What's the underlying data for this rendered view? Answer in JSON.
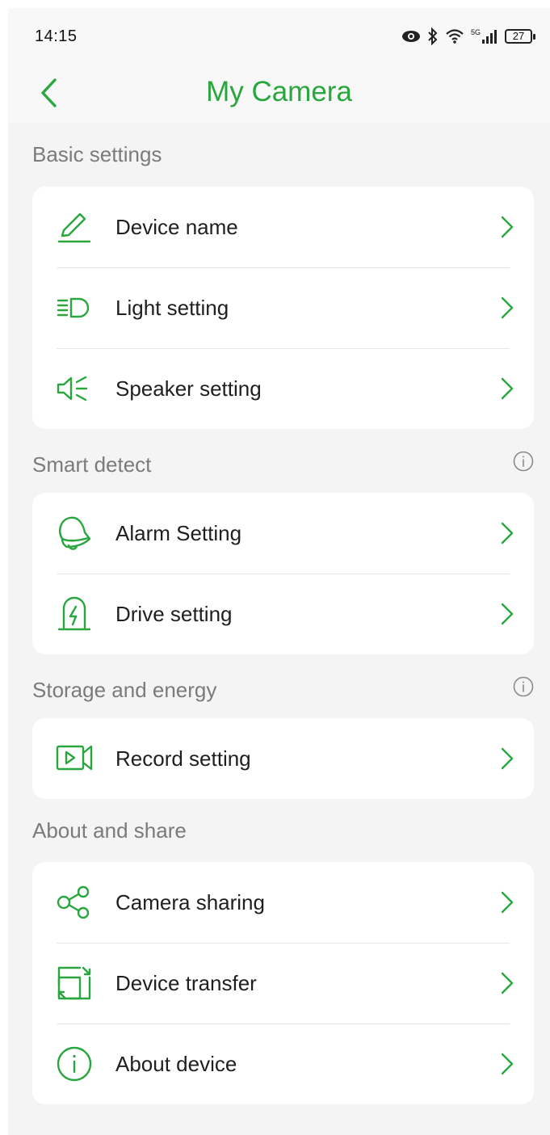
{
  "status_bar": {
    "time": "14:15",
    "network_label": "5G",
    "battery": "27",
    "icons": [
      "eye-icon",
      "bluetooth-icon",
      "wifi-icon",
      "signal-icon",
      "battery-icon"
    ]
  },
  "header": {
    "title": "My Camera",
    "back_icon": "chevron-left-icon"
  },
  "accent_color": "#2aa63e",
  "sections": [
    {
      "title": "Basic settings",
      "has_info": false,
      "items": [
        {
          "label": "Device name",
          "icon": "pencil-icon"
        },
        {
          "label": "Light setting",
          "icon": "headlight-icon"
        },
        {
          "label": "Speaker setting",
          "icon": "speaker-icon"
        }
      ]
    },
    {
      "title": "Smart detect",
      "has_info": true,
      "items": [
        {
          "label": "Alarm Setting",
          "icon": "alarm-bell-icon"
        },
        {
          "label": "Drive setting",
          "icon": "drive-bolt-icon"
        }
      ]
    },
    {
      "title": "Storage and energy",
      "has_info": true,
      "items": [
        {
          "label": "Record setting",
          "icon": "video-record-icon"
        }
      ]
    },
    {
      "title": "About and share",
      "has_info": false,
      "items": [
        {
          "label": "Camera sharing",
          "icon": "share-icon"
        },
        {
          "label": "Device transfer",
          "icon": "transfer-icon"
        },
        {
          "label": "About device",
          "icon": "info-circle-icon"
        }
      ]
    }
  ]
}
